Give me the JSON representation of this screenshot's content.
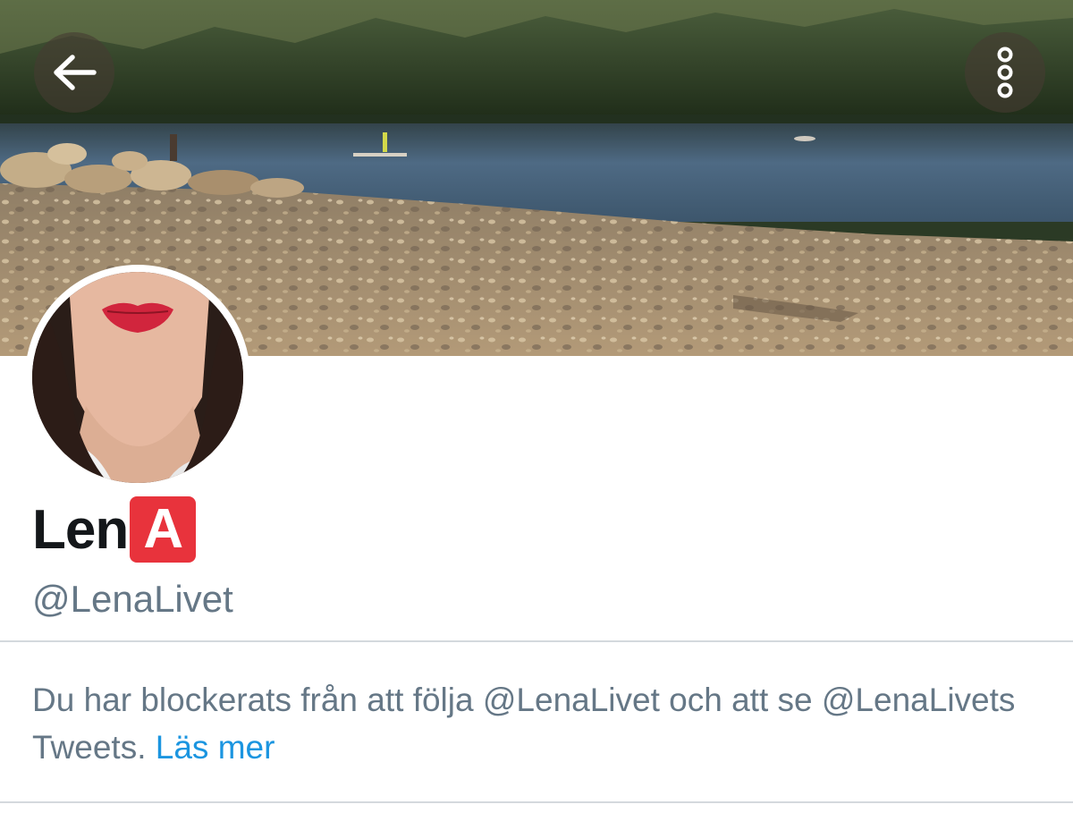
{
  "nav": {
    "back_icon": "arrow-left-icon",
    "more_icon": "vertical-dots-icon"
  },
  "profile": {
    "display_name": "Len",
    "name_badge": "A",
    "handle": "@LenaLivet"
  },
  "blocked_notice": {
    "text": "Du har blockerats från att följa @LenaLivet och att se @LenaLivets Tweets.",
    "link": "Läs mer"
  },
  "colors": {
    "primary_text": "#14171a",
    "secondary_text": "#657786",
    "link": "#1b95e0",
    "badge": "#e8333c",
    "divider": "#d4d9dd"
  }
}
